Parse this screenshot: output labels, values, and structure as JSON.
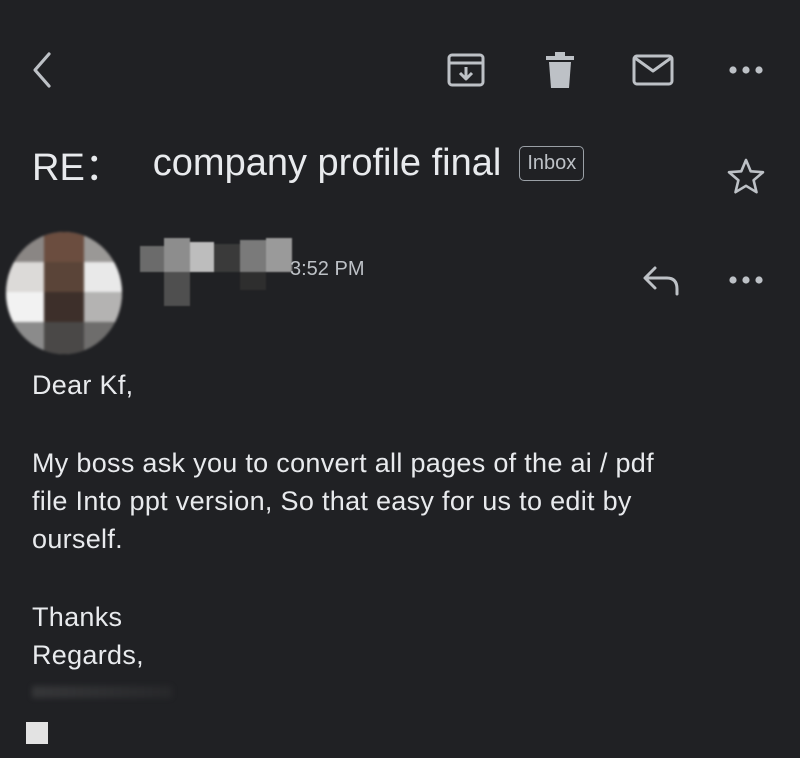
{
  "toolbar": {
    "back_icon": "chevron-left-icon",
    "archive_icon": "archive-icon",
    "delete_icon": "trash-icon",
    "mark_unread_icon": "mail-icon",
    "more_icon": "more-horizontal-icon"
  },
  "email": {
    "subject_prefix": "RE：",
    "subject": "company profile final",
    "label": "Inbox",
    "star_icon": "star-outline-icon",
    "time": "3:52 PM",
    "reply_icon": "reply-icon",
    "body": {
      "greeting": "Dear Kf,",
      "line1": "My boss ask you to convert all pages of the ai / pdf",
      "line2": "file Into ppt version, So that easy for us to edit by",
      "line3": "ourself.",
      "closing1": "Thanks",
      "closing2": "Regards,"
    }
  },
  "colors": {
    "background": "#202124",
    "text": "#e8eaed",
    "secondary": "#bdc1c6"
  }
}
